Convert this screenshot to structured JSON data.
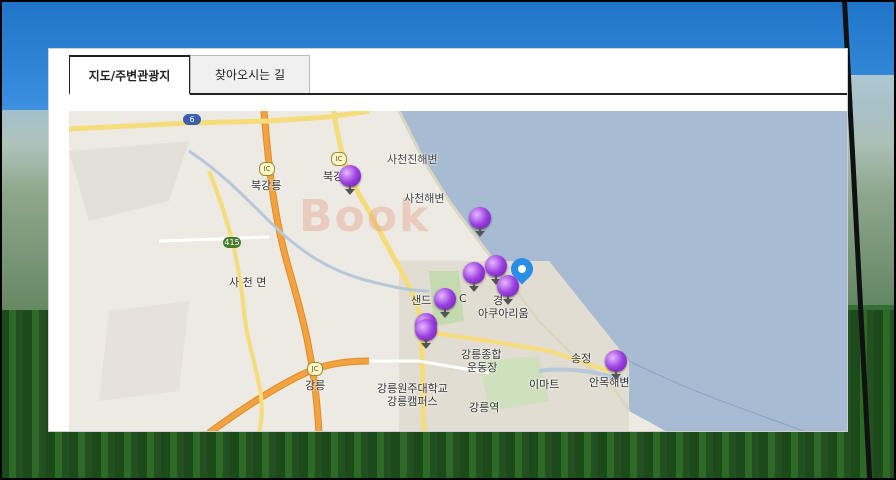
{
  "tabs": [
    {
      "label": "지도/주변관광지",
      "active": true
    },
    {
      "label": "찾아오시는 길",
      "active": false
    }
  ],
  "map": {
    "watermark": "Book",
    "labels": {
      "sacheonjin_beach": "사천진해변",
      "sacheon_beach": "사천해변",
      "bukgangneung": "북강릉",
      "bukgang": "북강",
      "sacheon_myeon": "사 천 면",
      "gangneung": "강릉",
      "sandeu": "샌드",
      "ic_small": "C",
      "gyeong": "경",
      "aquarium": "아쿠아리움",
      "sports_complex_1": "강릉종합",
      "sports_complex_2": "운동장",
      "emart": "이마트",
      "university_1": "강릉원주대학교",
      "university_2": "강릉캠퍼스",
      "station": "강릉역",
      "songjeong": "송정",
      "anmok": "안목해변"
    },
    "route_badges": {
      "r6": "6",
      "r415": "415",
      "ic": "IC",
      "jc": "JC"
    },
    "colors": {
      "sea": "#a7bcd3",
      "land": "#eceae3",
      "highway": "#f2a340",
      "road": "#f6dc7a",
      "pin": "#9b3fe0",
      "location_pin": "#2a8de8"
    },
    "pins_count": 9
  }
}
